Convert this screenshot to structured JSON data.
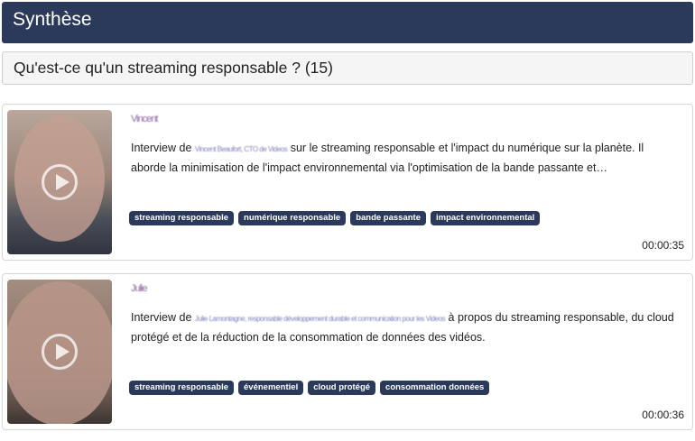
{
  "header": {
    "title": "Synthèse"
  },
  "section": {
    "title": "Qu'est-ce qu'un streaming responsable ? (15)"
  },
  "cards": [
    {
      "title_blurred": "Vincent",
      "desc_prefix": "Interview de",
      "desc_name_blurred": "Vincent Beaufort, CTO de Videos",
      "desc_rest": "sur le streaming responsable et l'impact du numérique sur la planète. Il aborde la minimisation de l'impact environnemental via l'optimisation de la bande passante et…",
      "tags": [
        "streaming responsable",
        "numérique responsable",
        "bande passante",
        "impact environnemental"
      ],
      "duration": "00:00:35"
    },
    {
      "title_blurred": "Julie",
      "desc_prefix": "Interview de",
      "desc_name_blurred": "Julie Lamontagne, responsable développement durable et communication pour les Videos",
      "desc_rest": "à propos du streaming responsable, du cloud protégé et de la réduction de la consommation de données des vidéos.",
      "tags": [
        "streaming responsable",
        "événementiel",
        "cloud protégé",
        "consommation données"
      ],
      "duration": "00:00:36"
    }
  ]
}
